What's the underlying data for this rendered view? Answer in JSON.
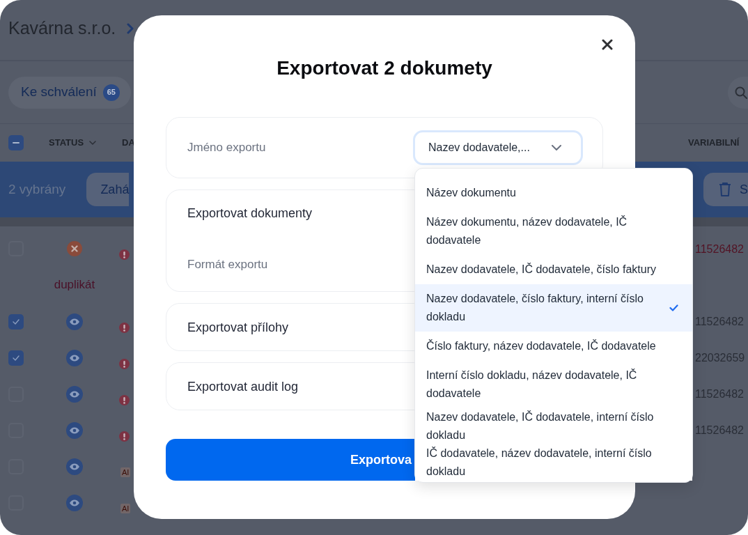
{
  "app": {
    "breadcrumb": {
      "company": "Kavárna s.r.o."
    },
    "tabs": [
      {
        "label": "Ke schválení",
        "count": "65",
        "selected": true
      }
    ],
    "table": {
      "select_all": {
        "indeterminate": true
      },
      "columns": [
        {
          "label": "STATUS",
          "sortable": true
        },
        {
          "label": "DA",
          "sortable": false
        },
        {
          "label": "VARIABILNÍ",
          "sortable": false
        }
      ],
      "selection_bar": {
        "label": "2 vybrány",
        "actions": [
          {
            "kind": "text",
            "label": "Zahá"
          },
          {
            "kind": "delete",
            "label": "S"
          }
        ]
      },
      "rows": [
        {
          "kind": "error",
          "checked": false,
          "status_label": "duplikát",
          "flag": {
            "kind": "alert"
          },
          "variable_symbol": "11526482"
        },
        {
          "kind": "viewed",
          "checked": true,
          "flag": {
            "kind": "alert"
          },
          "variable_symbol": "11526482"
        },
        {
          "kind": "viewed",
          "checked": true,
          "flag": {
            "kind": "alert"
          },
          "variable_symbol": "22032659"
        },
        {
          "kind": "viewed",
          "checked": false,
          "flag": {
            "kind": "alert"
          },
          "variable_symbol": "11526482"
        },
        {
          "kind": "viewed",
          "checked": false,
          "flag": {
            "kind": "alert"
          },
          "variable_symbol": "11526482"
        },
        {
          "kind": "viewed",
          "checked": false,
          "flag": {
            "kind": "ai",
            "label": "AI"
          }
        },
        {
          "kind": "viewed",
          "checked": false,
          "flag": {
            "kind": "ai",
            "label": "AI"
          }
        }
      ]
    }
  },
  "dialog": {
    "title": "Exportovat 2 dokumety",
    "sections": [
      {
        "kind": "select",
        "label": "Jméno exportu",
        "value": "Nazev dodavatele,...",
        "expanded": true,
        "options": [
          {
            "label": "Název dokumentu",
            "selected": false
          },
          {
            "label": "Název dokumentu, název dodavatele, IČ dodavatele",
            "selected": false
          },
          {
            "label": "Nazev dodavatele, IČ dodavatele, číslo faktury",
            "selected": false
          },
          {
            "label": "Nazev dodavatele, číslo faktury, interní číslo dokladu",
            "selected": true
          },
          {
            "label": "Číslo faktury, název dodavatele, IČ dodavatele",
            "selected": false
          },
          {
            "label": "Interní číslo dokladu, název dodavatele, IČ dodavatele",
            "selected": false
          },
          {
            "label": "Nazev dodavatele, IČ dodavatele, interní číslo dokladu",
            "selected": false
          },
          {
            "label": "IČ dodavatele, název dodavatele, interní číslo dokladu",
            "selected": false
          }
        ]
      },
      {
        "kind": "group",
        "title": "Exportovat dokumenty",
        "fields": [
          {
            "label": "Formát exportu"
          }
        ]
      },
      {
        "kind": "heading",
        "title": "Exportovat přílohy"
      },
      {
        "kind": "heading",
        "title": "Exportovat audit log"
      }
    ],
    "submit": {
      "label": "Exportova"
    }
  }
}
